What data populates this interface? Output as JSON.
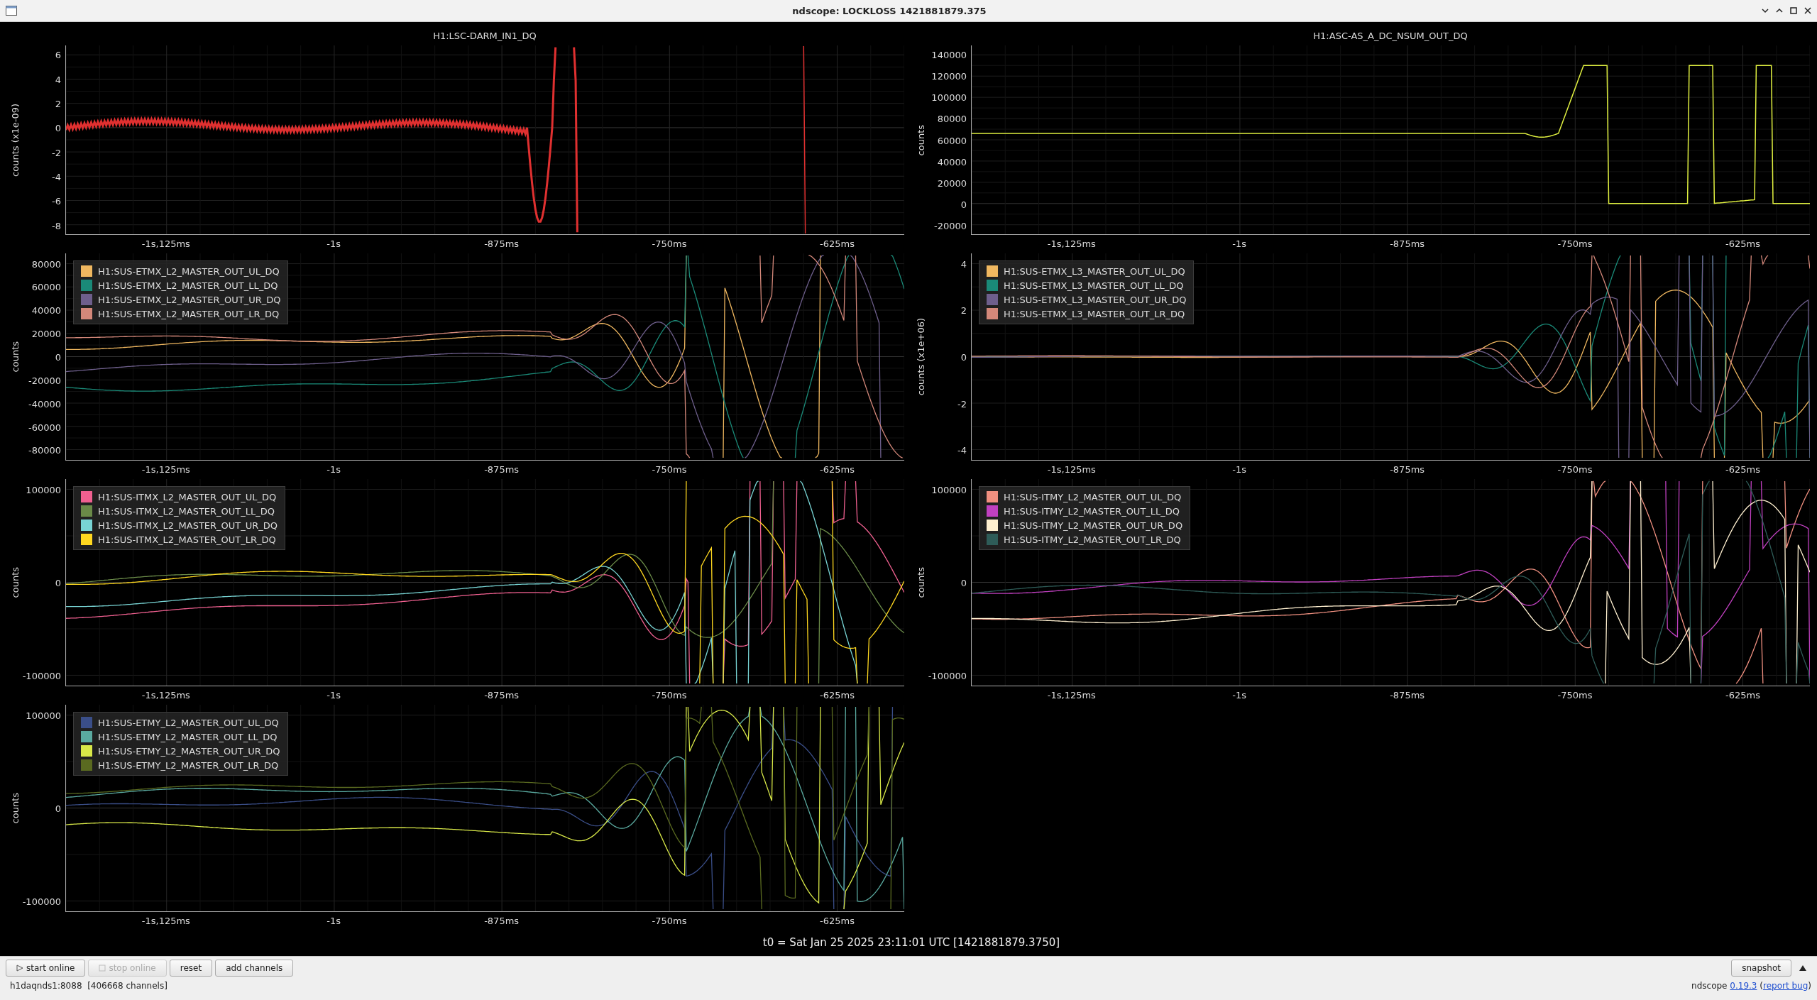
{
  "window": {
    "title": "ndscope: LOCKLOSS 1421881879.375"
  },
  "plots": [
    {
      "title": "H1:LSC-DARM_IN1_DQ",
      "kind": "dense",
      "y_label": "counts (x1e-09)",
      "yticks": [
        "6",
        "4",
        "2",
        "0",
        "-2",
        "-4",
        "-6",
        "-8"
      ],
      "xticks": [
        "-1s,125ms",
        "-1s",
        "-875ms",
        "-750ms",
        "-625ms"
      ]
    },
    {
      "title": "H1:ASC-AS_A_DC_NSUM_OUT_DQ",
      "kind": "steps",
      "y_label": "counts",
      "yticks": [
        "140000",
        "120000",
        "100000",
        "80000",
        "60000",
        "40000",
        "20000",
        "0",
        "-20000"
      ],
      "xticks": [
        "-1s,125ms",
        "-1s",
        "-875ms",
        "-750ms",
        "-625ms"
      ]
    },
    {
      "kind": "multi",
      "y_label": "counts",
      "yticks": [
        "80000",
        "60000",
        "40000",
        "20000",
        "0",
        "-20000",
        "-40000",
        "-60000",
        "-80000"
      ],
      "xticks": [
        "-1s,125ms",
        "-1s",
        "-875ms",
        "-750ms",
        "-625ms"
      ],
      "legend": [
        {
          "label": "H1:SUS-ETMX_L2_MASTER_OUT_UL_DQ",
          "color": "#f0b860"
        },
        {
          "label": "H1:SUS-ETMX_L2_MASTER_OUT_LL_DQ",
          "color": "#1a8a78"
        },
        {
          "label": "H1:SUS-ETMX_L2_MASTER_OUT_UR_DQ",
          "color": "#6e5f8c"
        },
        {
          "label": "H1:SUS-ETMX_L2_MASTER_OUT_LR_DQ",
          "color": "#d4887a"
        }
      ]
    },
    {
      "kind": "overlap",
      "y_label": "counts (x1e+06)",
      "yticks": [
        "4",
        "2",
        "0",
        "-2",
        "-4"
      ],
      "xticks": [
        "-1s,125ms",
        "-1s",
        "-875ms",
        "-750ms",
        "-625ms"
      ],
      "legend": [
        {
          "label": "H1:SUS-ETMX_L3_MASTER_OUT_UL_DQ",
          "color": "#f0b860"
        },
        {
          "label": "H1:SUS-ETMX_L3_MASTER_OUT_LL_DQ",
          "color": "#1a8a78"
        },
        {
          "label": "H1:SUS-ETMX_L3_MASTER_OUT_UR_DQ",
          "color": "#6e5f8c"
        },
        {
          "label": "H1:SUS-ETMX_L3_MASTER_OUT_LR_DQ",
          "color": "#d4887a"
        }
      ]
    },
    {
      "kind": "multi",
      "y_label": "counts",
      "yticks": [
        "100000",
        "0",
        "-100000"
      ],
      "xticks": [
        "-1s,125ms",
        "-1s",
        "-875ms",
        "-750ms",
        "-625ms"
      ],
      "legend": [
        {
          "label": "H1:SUS-ITMX_L2_MASTER_OUT_UL_DQ",
          "color": "#f06090"
        },
        {
          "label": "H1:SUS-ITMX_L2_MASTER_OUT_LL_DQ",
          "color": "#6a8a48"
        },
        {
          "label": "H1:SUS-ITMX_L2_MASTER_OUT_UR_DQ",
          "color": "#78d4d4"
        },
        {
          "label": "H1:SUS-ITMX_L2_MASTER_OUT_LR_DQ",
          "color": "#ffd820"
        }
      ]
    },
    {
      "kind": "multi",
      "y_label": "counts",
      "yticks": [
        "100000",
        "0",
        "-100000"
      ],
      "xticks": [
        "-1s,125ms",
        "-1s",
        "-875ms",
        "-750ms",
        "-625ms"
      ],
      "legend": [
        {
          "label": "H1:SUS-ITMY_L2_MASTER_OUT_UL_DQ",
          "color": "#f09080"
        },
        {
          "label": "H1:SUS-ITMY_L2_MASTER_OUT_LL_DQ",
          "color": "#c040c0"
        },
        {
          "label": "H1:SUS-ITMY_L2_MASTER_OUT_UR_DQ",
          "color": "#fff0d0"
        },
        {
          "label": "H1:SUS-ITMY_L2_MASTER_OUT_LR_DQ",
          "color": "#2e5c58"
        }
      ]
    },
    {
      "kind": "multi",
      "y_label": "counts",
      "yticks": [
        "100000",
        "0",
        "-100000"
      ],
      "xticks": [
        "-1s,125ms",
        "-1s",
        "-875ms",
        "-750ms",
        "-625ms"
      ],
      "legend": [
        {
          "label": "H1:SUS-ETMY_L2_MASTER_OUT_UL_DQ",
          "color": "#3a4e88"
        },
        {
          "label": "H1:SUS-ETMY_L2_MASTER_OUT_LL_DQ",
          "color": "#5aaaa0"
        },
        {
          "label": "H1:SUS-ETMY_L2_MASTER_OUT_UR_DQ",
          "color": "#d8e848"
        },
        {
          "label": "H1:SUS-ETMY_L2_MASTER_OUT_LR_DQ",
          "color": "#5a6a20"
        }
      ]
    }
  ],
  "t0": "t0 = Sat Jan 25 2025 23:11:01 UTC [1421881879.3750]",
  "buttons": [
    {
      "label": "start online",
      "kind": "play",
      "disabled": false
    },
    {
      "label": "stop online",
      "kind": "stop",
      "disabled": true
    },
    {
      "label": "reset",
      "kind": "plain",
      "disabled": false
    },
    {
      "label": "add channels",
      "kind": "plain",
      "disabled": false
    }
  ],
  "snapshot_button": "snapshot",
  "status": {
    "server": "h1daqnds1:8088  [406668 channels]",
    "app": "ndscope",
    "version": "0.19.3",
    "open": "(",
    "report": "report bug",
    "close": ")"
  }
}
